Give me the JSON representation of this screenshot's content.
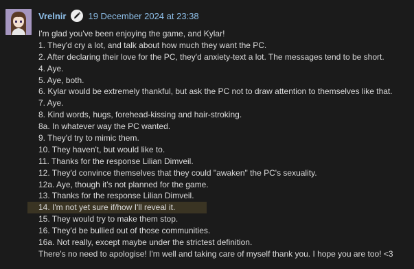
{
  "comment": {
    "author": "Vrelnir",
    "timestamp": "19 December 2024 at 23:38",
    "highlight_color": "#3a3423",
    "link_color": "#8fc0ea",
    "icons": {
      "avatar": "avatar-portrait",
      "edit": "pencil-icon"
    },
    "lines": [
      "I'm glad you've been enjoying the game, and Kylar!",
      "1. They'd cry a lot, and talk about how much they want the PC.",
      "2. After declaring their love for the PC, they'd anxiety-text a lot. The messages tend to be short.",
      "4. Aye.",
      "5. Aye, both.",
      "6. Kylar would be extremely thankful, but ask the PC not to draw attention to themselves like that.",
      "7. Aye.",
      "8. Kind words, hugs, forehead-kissing and hair-stroking.",
      "8a. In whatever way the PC wanted.",
      "9. They'd try to mimic them.",
      "10. They haven't, but would like to.",
      "11. Thanks for the response Lilian Dimveil.",
      "12. They'd convince themselves that they could \"awaken\" the PC's sexuality.",
      "12a. Aye, though it's not planned for the game.",
      "13. Thanks for the response Lilian Dimveil.",
      "14. I'm not yet sure if/how I'll reveal it.",
      "15. They would try to make them stop.",
      "16. They'd be bullied out of those communities.",
      "16a. Not really, except maybe under the strictest definition.",
      "There's no need to apologise! I'm well and taking care of myself thank you. I hope you are too! <3"
    ]
  }
}
